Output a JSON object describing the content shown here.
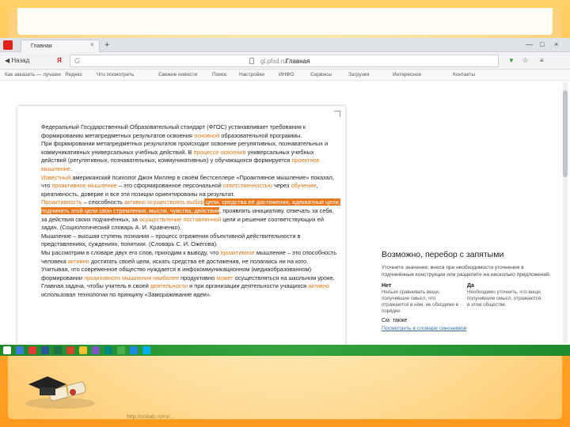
{
  "browser": {
    "tab_title": "Главная",
    "tab_close": "×",
    "new_tab": "+",
    "window_controls": [
      "—",
      "□",
      "×"
    ],
    "toolbar": {
      "back_label": "Назад",
      "yandex_logo": "Я",
      "address_prefix": "G",
      "address_host": "gl.pfsd.ru",
      "address_title": "Главная",
      "right_icons": [
        "download-icon",
        "bookmark-icon",
        "menu-icon"
      ]
    },
    "bookmarks": [
      "Как заказать — лучшее",
      "Яндекс",
      "Что посмотреть",
      "Свежие новости",
      "Поиск",
      "Настройки",
      "ИНФО",
      "Сервисы",
      "Загрузки",
      "Интересное",
      "Контакты"
    ]
  },
  "article": {
    "paragraphs": [
      [
        {
          "t": "Федеральный Государственный Образовательный стандарт (ФГОС) устанавливает требования к формированию метапредметных результатов освоения "
        },
        {
          "t": "основной",
          "c": "o"
        },
        {
          "t": " образовательной программы."
        }
      ],
      [
        {
          "t": "При формировании метапредметных результатов происходит освоение регулятивных, познавательных и коммуникативных универсальных учебных действий. В "
        },
        {
          "t": "процессе освоения",
          "c": "o"
        },
        {
          "t": " универсальных учебных действий (регулятивных, познавательных, коммуникативных) у обучающихся формируется "
        },
        {
          "t": "проектное мышление",
          "c": "o"
        },
        {
          "t": "."
        }
      ],
      [
        {
          "t": "Известный",
          "c": "o"
        },
        {
          "t": " американский психолог Джон Миллер в своём бестселлере «Проактивное мышление» показал, что "
        },
        {
          "t": "проактивное мышление",
          "c": "o"
        },
        {
          "t": " – это сформированное персональной "
        },
        {
          "t": "ответственностью",
          "c": "o"
        },
        {
          "t": " через "
        },
        {
          "t": "обучение",
          "c": "o"
        },
        {
          "t": ", креативность, доверие и все эти позиции ориентированы на результат."
        }
      ],
      [
        {
          "t": "Проактивность",
          "c": "o"
        },
        {
          "t": " – способность "
        },
        {
          "t": "активно осуществлять выбор",
          "c": "o"
        },
        {
          "t": " цели, средства её достижения, адекватные цели, подчинять этой цели свои стремления, мысли, чувства, действия",
          "c": "hl"
        },
        {
          "t": ", проявлять инициативу, отвечать за себя, за действия своих подчинённых, за "
        },
        {
          "t": "осуществление поставленной",
          "c": "o"
        },
        {
          "t": " цели и решение соответствующих ей задач. (Социологический словарь А. И. Кравченко)."
        }
      ],
      [
        {
          "t": "Мышление – высшая ступень познания – процесс отражения объективной действительности в представлениях, суждениях, понятиях. (Словарь С. И. Ожегова)."
        }
      ],
      [
        {
          "t": "Мы рассмотрим в словаре двух его слов, приходим к выводу, что "
        },
        {
          "t": "проактивное",
          "c": "o"
        },
        {
          "t": " мышление – это способность человека "
        },
        {
          "t": "активно",
          "c": "o"
        },
        {
          "t": " достигать своей цели, искать средства её достижения, не полагаясь ни на кого."
        }
      ],
      [
        {
          "t": "Учитывая, что современное общество нуждается в инфокоммуникационном (медиаобразованном) формировании "
        },
        {
          "t": "проактивного мышления",
          "c": "o"
        },
        {
          "t": " "
        },
        {
          "t": "наиболее",
          "c": "o"
        },
        {
          "t": " продуктивно "
        },
        {
          "t": "может",
          "c": "o"
        },
        {
          "t": " осуществляться на школьном уроке. Главная задача, чтобы учитель в своей "
        },
        {
          "t": "деятельности",
          "c": "o"
        },
        {
          "t": " и при организации деятельности учащихся "
        },
        {
          "t": "активно",
          "c": "o"
        },
        {
          "t": " использовал технологии по принципу «Замораживание идеи»."
        }
      ]
    ]
  },
  "sidebar": {
    "title": "Возможно, перебор с запятыми",
    "description": "Уточните значение, внеся при необходимости уточнения в подчинённые конструкции или разделите на несколько предложений.",
    "left_col": {
      "heading": "Нет",
      "text": "Нельзя сравнивать вещи, получившие смысл, что отражаются в нём, не обходимо в порядке."
    },
    "right_col": {
      "heading": "Да",
      "text": "Необходимо уточнить, что вещи, получившие смысл, отражаются в этом обществе."
    },
    "see_also": "См. также",
    "link": "Посмотреть в словаре синонимов"
  },
  "footer": {
    "url": "http://ooliab.ru/ru/..."
  },
  "colors": {
    "highlight": "#e8791f",
    "orange_text": "#e07515",
    "taskbar": "#2e9b39"
  },
  "taskbar_icons": [
    "start-icon",
    "explorer-icon",
    "yandex-icon",
    "word-icon",
    "excel-icon",
    "powerpoint-icon",
    "folder-icon",
    "photo-icon",
    "media-icon",
    "chrome-icon",
    "mail-icon",
    "skype-icon"
  ]
}
